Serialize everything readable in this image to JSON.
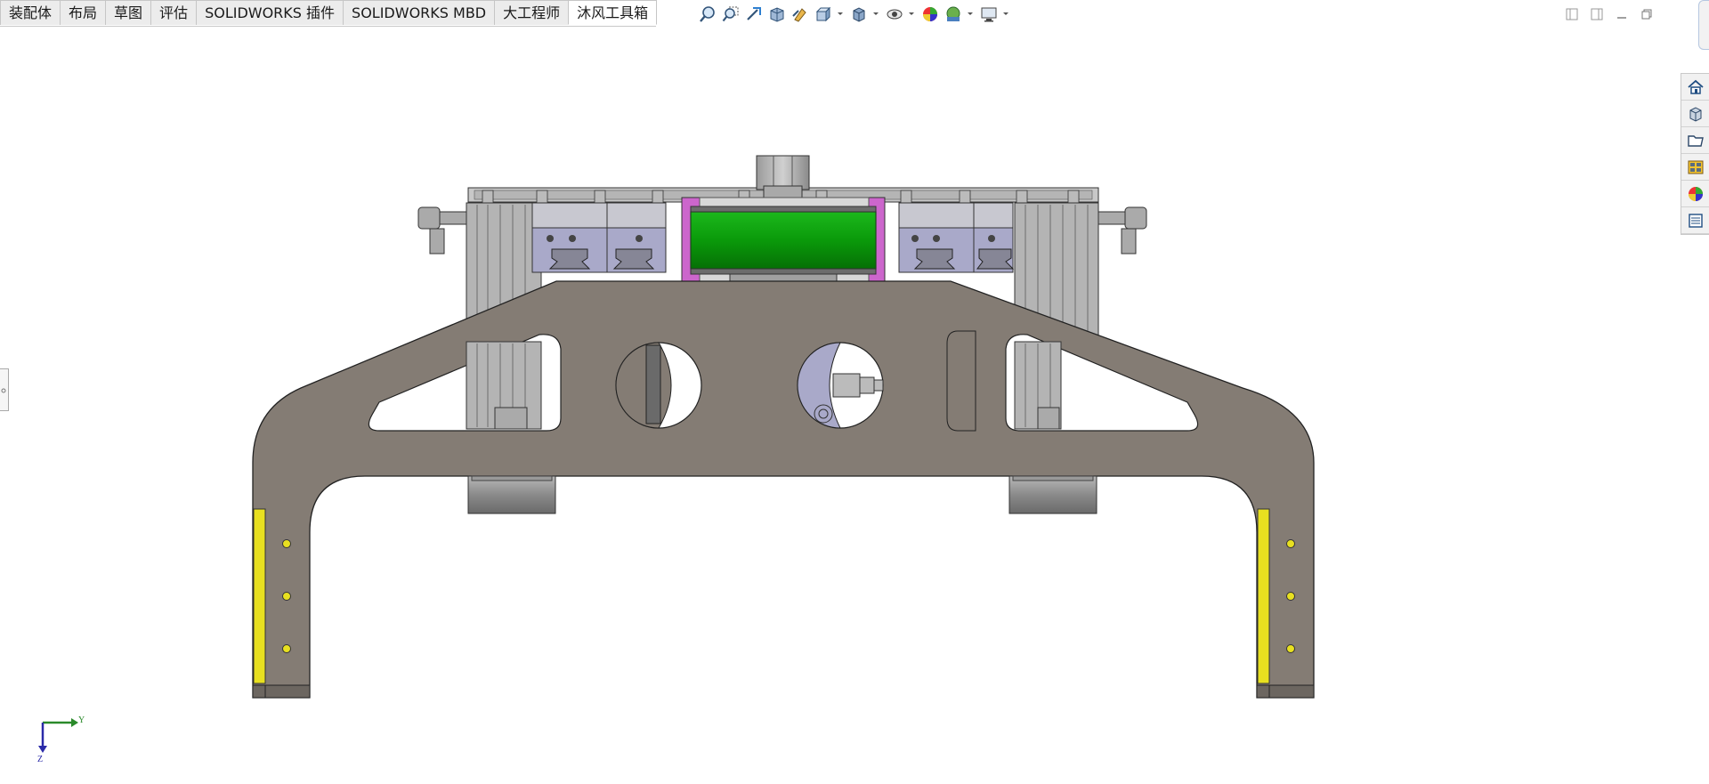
{
  "tabs": [
    {
      "label": "装配体",
      "active": false
    },
    {
      "label": "布局",
      "active": false
    },
    {
      "label": "草图",
      "active": false
    },
    {
      "label": "评估",
      "active": false
    },
    {
      "label": "SOLIDWORKS 插件",
      "active": false
    },
    {
      "label": "SOLIDWORKS MBD",
      "active": false
    },
    {
      "label": "大工程师",
      "active": false
    },
    {
      "label": "沐风工具箱",
      "active": true
    }
  ],
  "view_toolbar": {
    "icons": [
      "zoom-to-fit-icon",
      "zoom-to-area-icon",
      "previous-view-icon",
      "section-view-icon",
      "dynamic-annotation-icon",
      "view-orientation-icon",
      "display-style-icon",
      "hide-show-items-icon",
      "edit-appearance-icon",
      "apply-scene-icon",
      "view-settings-icon"
    ]
  },
  "task_pane": {
    "icons": [
      "home-icon",
      "design-library-icon",
      "file-explorer-icon",
      "view-palette-icon",
      "appearances-icon",
      "custom-properties-icon"
    ]
  },
  "triad": {
    "y_label": "Y",
    "z_label": "Z"
  },
  "colors": {
    "frame": "#847c74",
    "rail": "#a8a8c8",
    "green_part": "#0a9a0a",
    "magenta_part": "#cc66cc",
    "yellow_strip": "#e8e020",
    "axis_y": "#2a8a2a",
    "axis_z": "#2a2aa8"
  }
}
